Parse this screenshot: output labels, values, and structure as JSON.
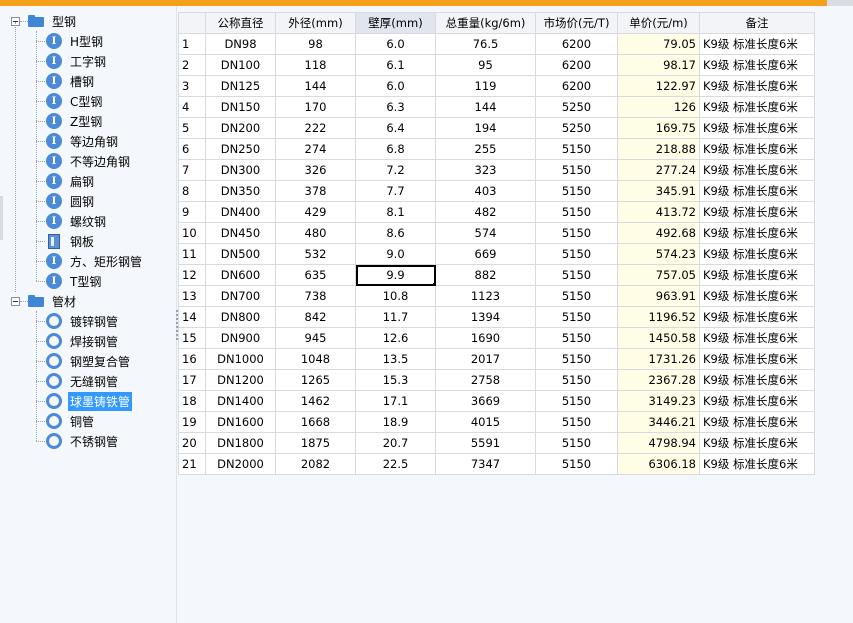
{
  "tree": {
    "groups": [
      {
        "label": "型钢",
        "icon": "folder-icon",
        "items": [
          {
            "label": "H型钢",
            "icon": "ibeam-icon"
          },
          {
            "label": "工字钢",
            "icon": "ibeam-icon"
          },
          {
            "label": "槽钢",
            "icon": "ibeam-icon"
          },
          {
            "label": "C型钢",
            "icon": "ibeam-icon"
          },
          {
            "label": "Z型钢",
            "icon": "ibeam-icon"
          },
          {
            "label": "等边角钢",
            "icon": "ibeam-icon"
          },
          {
            "label": "不等边角钢",
            "icon": "ibeam-icon"
          },
          {
            "label": "扁钢",
            "icon": "ibeam-icon"
          },
          {
            "label": "圆钢",
            "icon": "ibeam-icon"
          },
          {
            "label": "螺纹钢",
            "icon": "ibeam-icon"
          },
          {
            "label": "钢板",
            "icon": "plate-icon"
          },
          {
            "label": "方、矩形钢管",
            "icon": "ibeam-icon"
          },
          {
            "label": "T型钢",
            "icon": "ibeam-icon"
          }
        ]
      },
      {
        "label": "管材",
        "icon": "folder-icon",
        "items": [
          {
            "label": "镀锌钢管",
            "icon": "ring-icon"
          },
          {
            "label": "焊接钢管",
            "icon": "ring-icon"
          },
          {
            "label": "钢塑复合管",
            "icon": "ring-icon"
          },
          {
            "label": "无缝钢管",
            "icon": "ring-icon"
          },
          {
            "label": "球墨铸铁管",
            "icon": "ring-icon",
            "selected": true
          },
          {
            "label": "铜管",
            "icon": "ring-icon"
          },
          {
            "label": "不锈钢管",
            "icon": "ring-icon"
          }
        ]
      }
    ]
  },
  "table": {
    "columns": [
      "",
      "公称直径",
      "外径(mm)",
      "壁厚(mm)",
      "总重量(kg/6m)",
      "市场价(元/T)",
      "单价(元/m)",
      "备注"
    ],
    "rows": [
      [
        "1",
        "DN98",
        "98",
        "6.0",
        "76.5",
        "6200",
        "79.05",
        "K9级 标准长度6米"
      ],
      [
        "2",
        "DN100",
        "118",
        "6.1",
        "95",
        "6200",
        "98.17",
        "K9级 标准长度6米"
      ],
      [
        "3",
        "DN125",
        "144",
        "6.0",
        "119",
        "6200",
        "122.97",
        "K9级 标准长度6米"
      ],
      [
        "4",
        "DN150",
        "170",
        "6.3",
        "144",
        "5250",
        "126",
        "K9级 标准长度6米"
      ],
      [
        "5",
        "DN200",
        "222",
        "6.4",
        "194",
        "5250",
        "169.75",
        "K9级 标准长度6米"
      ],
      [
        "6",
        "DN250",
        "274",
        "6.8",
        "255",
        "5150",
        "218.88",
        "K9级 标准长度6米"
      ],
      [
        "7",
        "DN300",
        "326",
        "7.2",
        "323",
        "5150",
        "277.24",
        "K9级 标准长度6米"
      ],
      [
        "8",
        "DN350",
        "378",
        "7.7",
        "403",
        "5150",
        "345.91",
        "K9级 标准长度6米"
      ],
      [
        "9",
        "DN400",
        "429",
        "8.1",
        "482",
        "5150",
        "413.72",
        "K9级 标准长度6米"
      ],
      [
        "10",
        "DN450",
        "480",
        "8.6",
        "574",
        "5150",
        "492.68",
        "K9级 标准长度6米"
      ],
      [
        "11",
        "DN500",
        "532",
        "9.0",
        "669",
        "5150",
        "574.23",
        "K9级 标准长度6米"
      ],
      [
        "12",
        "DN600",
        "635",
        "9.9",
        "882",
        "5150",
        "757.05",
        "K9级 标准长度6米"
      ],
      [
        "13",
        "DN700",
        "738",
        "10.8",
        "1123",
        "5150",
        "963.91",
        "K9级 标准长度6米"
      ],
      [
        "14",
        "DN800",
        "842",
        "11.7",
        "1394",
        "5150",
        "1196.52",
        "K9级 标准长度6米"
      ],
      [
        "15",
        "DN900",
        "945",
        "12.6",
        "1690",
        "5150",
        "1450.58",
        "K9级 标准长度6米"
      ],
      [
        "16",
        "DN1000",
        "1048",
        "13.5",
        "2017",
        "5150",
        "1731.26",
        "K9级 标准长度6米"
      ],
      [
        "17",
        "DN1200",
        "1265",
        "15.3",
        "2758",
        "5150",
        "2367.28",
        "K9级 标准长度6米"
      ],
      [
        "18",
        "DN1400",
        "1462",
        "17.1",
        "3669",
        "5150",
        "3149.23",
        "K9级 标准长度6米"
      ],
      [
        "19",
        "DN1600",
        "1668",
        "18.9",
        "4015",
        "5150",
        "3446.21",
        "K9级 标准长度6米"
      ],
      [
        "20",
        "DN1800",
        "1875",
        "20.7",
        "5591",
        "5150",
        "4798.94",
        "K9级 标准长度6米"
      ],
      [
        "21",
        "DN2000",
        "2082",
        "22.5",
        "7347",
        "5150",
        "6306.18",
        "K9级 标准长度6米"
      ]
    ],
    "selected_column": 3,
    "current_cell": {
      "row": 11,
      "col": 3
    }
  },
  "colors": {
    "accent_bar": "#f5a01a",
    "selection": "#3399ff",
    "price_column": "#fffde6"
  }
}
